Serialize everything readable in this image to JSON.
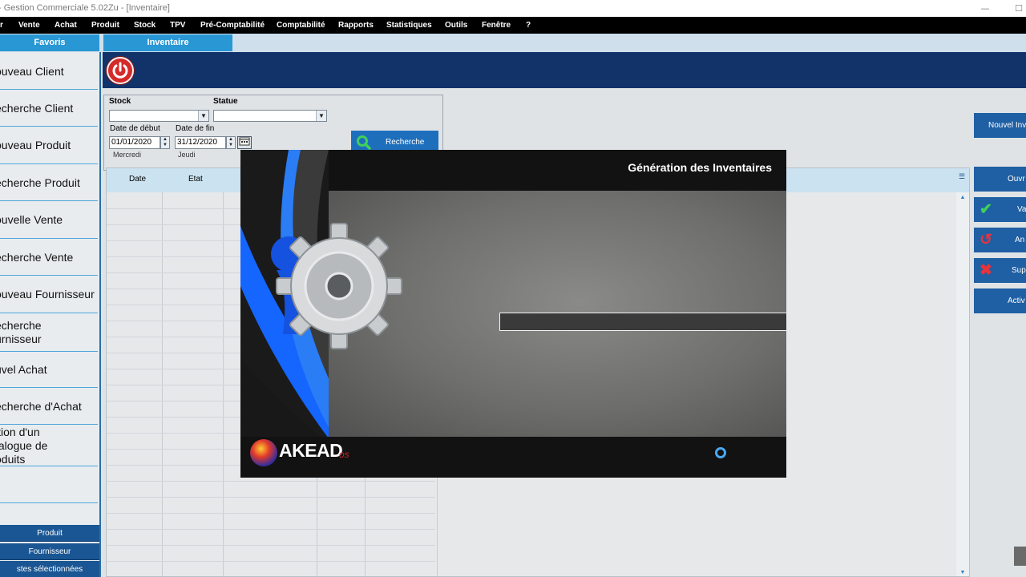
{
  "window": {
    "title": "- Gestion Commerciale 5.02Zu  - [Inventaire]",
    "minimize_label": "—",
    "maximize_label": "☐"
  },
  "menubar": {
    "items": [
      "r",
      "Vente",
      "Achat",
      "Produit",
      "Stock",
      "TPV",
      "Pré-Comptabilité",
      "Comptabilité",
      "Rapports",
      "Statistiques",
      "Outils",
      "Fenêtre",
      "?"
    ]
  },
  "tabs": {
    "favoris": "Favoris",
    "inventaire": "Inventaire"
  },
  "sidebar": {
    "items": [
      {
        "label": "ouveau Client"
      },
      {
        "label": "echerche Client"
      },
      {
        "label": "ouveau Produit"
      },
      {
        "label": "echerche Produit"
      },
      {
        "label": "ouvelle Vente"
      },
      {
        "label": "echerche Vente"
      },
      {
        "label": "ouveau Fournisseur"
      },
      {
        "label_line1": "echerche",
        "label_line2": "urnisseur"
      },
      {
        "label": "uvel Achat"
      },
      {
        "label": "echerche d'Achat"
      },
      {
        "label_line1": "ition d'un",
        "label_line2": "talogue de",
        "label_line3": "oduits"
      }
    ],
    "bottom": [
      "Produit",
      "Fournisseur",
      "stes sélectionnées"
    ]
  },
  "filter": {
    "stock_label": "Stock",
    "statue_label": "Statue",
    "stock_value": "",
    "statue_value": "",
    "date_debut_label": "Date de début",
    "date_fin_label": "Date de fin",
    "date_debut": "01/01/2020",
    "date_fin": "31/12/2020",
    "day_debut": "Mercredi",
    "day_fin": "Jeudi",
    "search_button": "Recherche"
  },
  "grid": {
    "columns": [
      "Date",
      "Etat"
    ]
  },
  "actions": {
    "nouvel_inventaire": "Nouvel Inv",
    "ouvrir": "Ouvr",
    "valider": "Va",
    "annuler": "An",
    "supprimer": "Supp",
    "activer": "Activ"
  },
  "splash": {
    "title": "Génération des Inventaires",
    "progress": 0,
    "brand": "AKEAD",
    "brand_suffix": "os"
  },
  "colors": {
    "accent_blue": "#2997d4",
    "banner_navy": "#11336a",
    "action_blue": "#1f5fa3",
    "power_red": "#d42a2a"
  }
}
